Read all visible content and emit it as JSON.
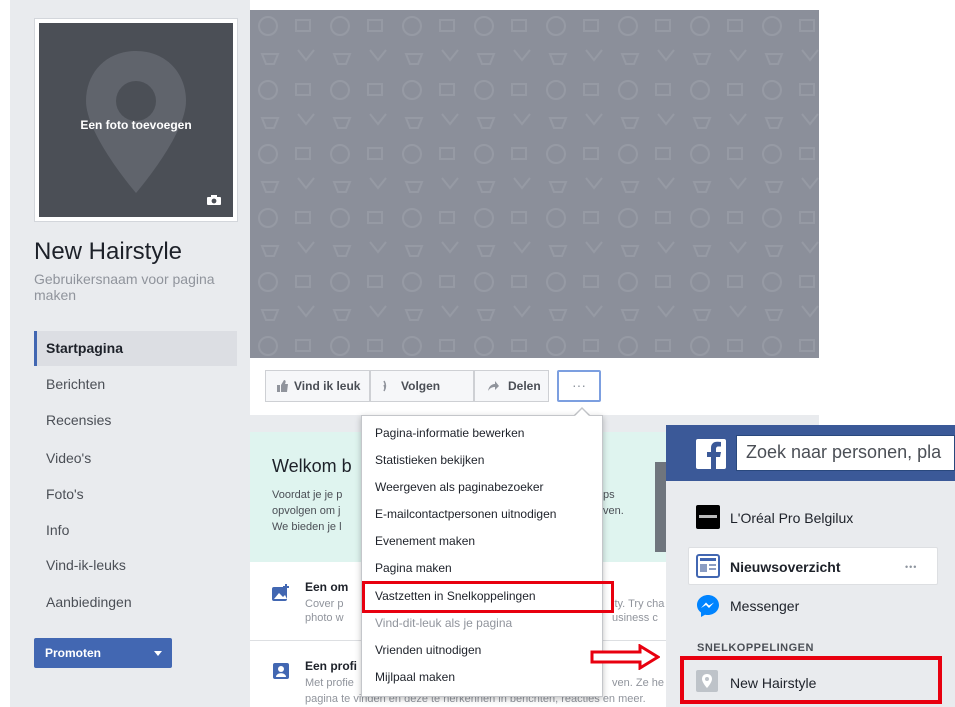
{
  "profile": {
    "add_photo_label": "Een foto toevoegen",
    "page_name": "New Hairstyle",
    "username_prompt": "Gebruikersnaam voor pagina maken"
  },
  "nav": {
    "items": [
      "Startpagina",
      "Berichten",
      "Recensies",
      "Video's",
      "Foto's",
      "Info",
      "Vind-ik-leuks",
      "Aanbiedingen"
    ],
    "active": "Startpagina"
  },
  "promote": {
    "label": "Promoten"
  },
  "actions": {
    "like": "Vind ik leuk",
    "follow": "Volgen",
    "share": "Delen",
    "more": "···"
  },
  "dropdown": {
    "items": [
      "Pagina-informatie bewerken",
      "Statistieken bekijken",
      "Weergeven als paginabezoeker",
      "E-mailcontactpersonen uitnodigen",
      "Evenement maken",
      "Pagina maken",
      "Vastzetten in Snelkoppelingen",
      "Vind-dit-leuk als je pagina",
      "Vrienden uitnodigen",
      "Mijlpaal maken"
    ]
  },
  "welcome": {
    "title": "Welkom b",
    "lines": [
      "Voordat je je p",
      "opvolgen om j",
      "We bieden je l"
    ],
    "right_fragments": [
      "ps",
      "ven."
    ]
  },
  "cards": [
    {
      "title": "Een om",
      "line1": "Cover p",
      "line1_right": "ity. Try cha",
      "line2": "photo w",
      "line2_right": "usiness c"
    },
    {
      "title": "Een profi",
      "line1": "Met profie",
      "line1_right": "ven. Ze he",
      "line2": "pagina te vinden en deze te herkennen in berichten, reacties en meer."
    }
  ],
  "sidebar_fb": {
    "search_placeholder": "Zoek naar personen, pla",
    "items": {
      "oreal": "L'Oréal Pro Belgilux",
      "news": "Nieuwsoverzicht",
      "messenger": "Messenger",
      "shortcuts_label": "SNELKOPPELINGEN",
      "new_hairstyle": "New Hairstyle"
    },
    "news_more": "•••"
  },
  "colors": {
    "facebook_blue": "#3b5998",
    "button_blue": "#4267b2",
    "highlight_red": "#e8000f"
  }
}
